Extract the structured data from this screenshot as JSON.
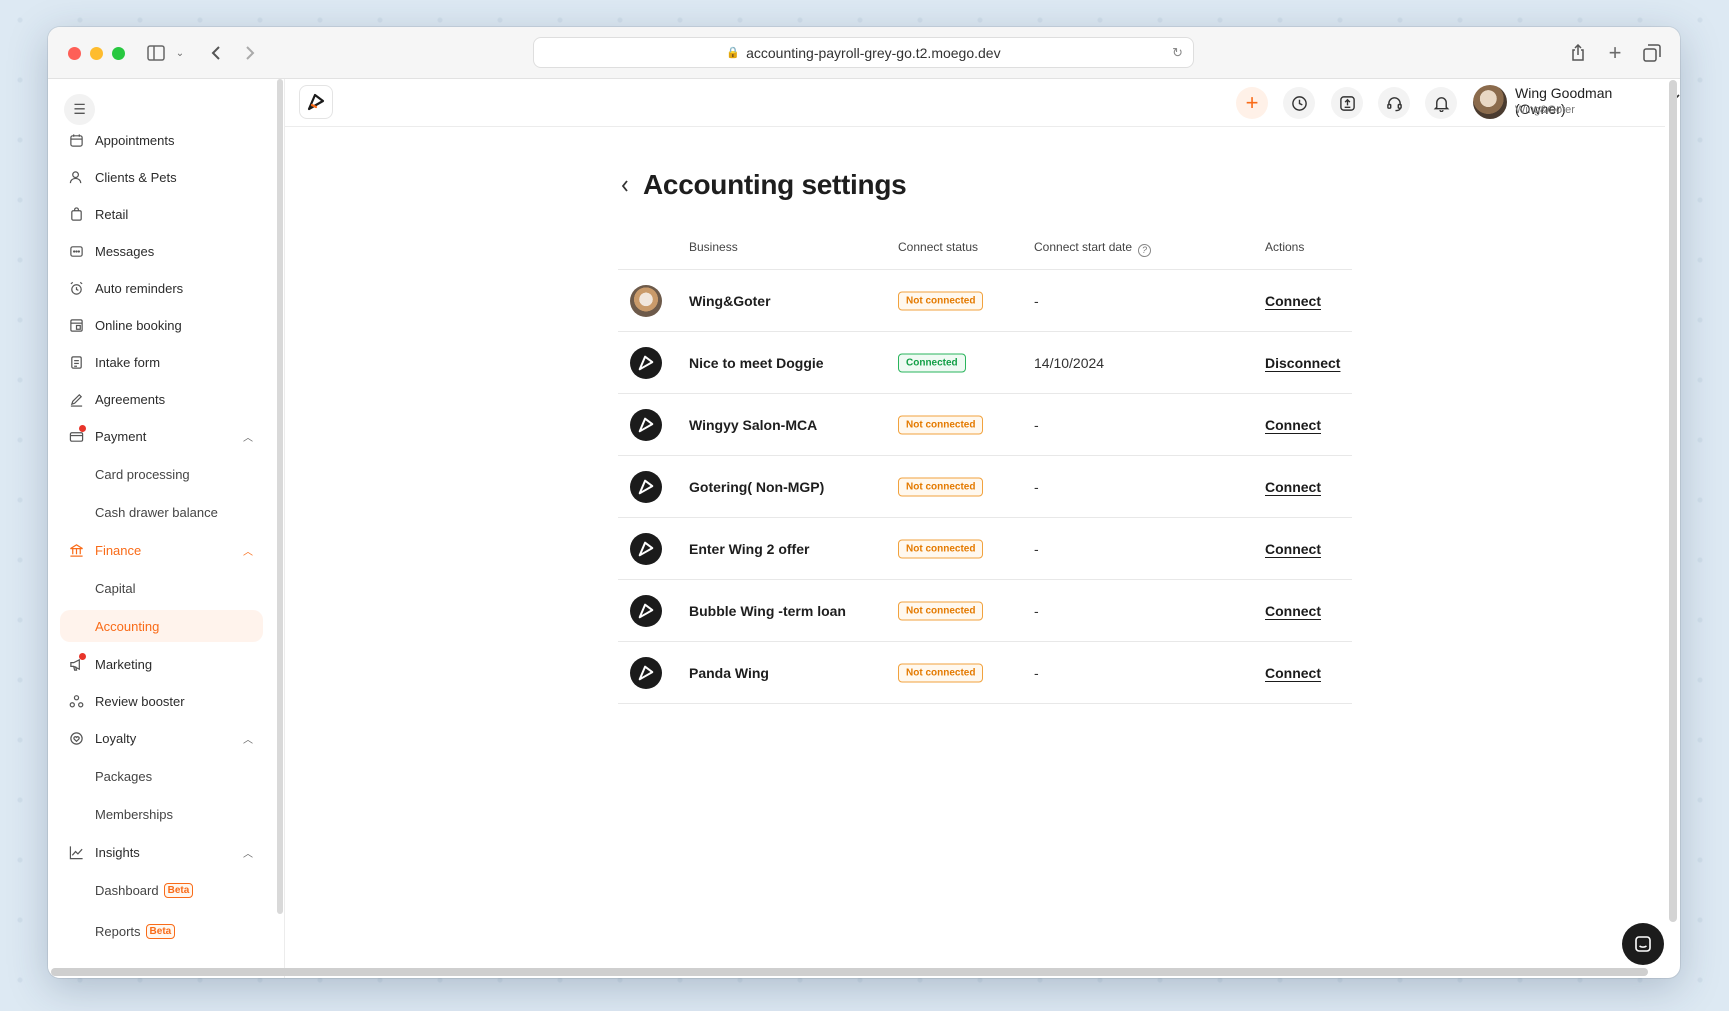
{
  "browser": {
    "url": "accounting-payroll-grey-go.t2.moego.dev"
  },
  "sidebar": {
    "items": [
      {
        "label": "Appointments",
        "icon": "calendar-icon"
      },
      {
        "label": "Clients & Pets",
        "icon": "user-icon"
      },
      {
        "label": "Retail",
        "icon": "bag-icon"
      },
      {
        "label": "Messages",
        "icon": "message-icon"
      },
      {
        "label": "Auto reminders",
        "icon": "alarm-icon"
      },
      {
        "label": "Online booking",
        "icon": "booking-icon"
      },
      {
        "label": "Intake form",
        "icon": "form-icon"
      },
      {
        "label": "Agreements",
        "icon": "pen-icon"
      },
      {
        "label": "Payment",
        "icon": "payment-icon"
      },
      {
        "label": "Card processing"
      },
      {
        "label": "Cash drawer balance"
      },
      {
        "label": "Finance",
        "icon": "bank-icon"
      },
      {
        "label": "Capital"
      },
      {
        "label": "Accounting"
      },
      {
        "label": "Marketing",
        "icon": "megaphone-icon"
      },
      {
        "label": "Review booster",
        "icon": "review-icon"
      },
      {
        "label": "Loyalty",
        "icon": "loyalty-icon"
      },
      {
        "label": "Packages"
      },
      {
        "label": "Memberships"
      },
      {
        "label": "Insights",
        "icon": "chart-icon"
      },
      {
        "label": "Dashboard",
        "badge": "Beta"
      },
      {
        "label": "Reports",
        "badge": "Beta"
      }
    ]
  },
  "header": {
    "user_name": "Wing Goodman (Owner)",
    "business": "Wing&Goter"
  },
  "main": {
    "title": "Accounting settings",
    "columns": {
      "business": "Business",
      "status": "Connect status",
      "start_date": "Connect start date",
      "actions": "Actions"
    },
    "rows": [
      {
        "name": "Wing&Goter",
        "status": "Not connected",
        "date": "-",
        "action": "Connect"
      },
      {
        "name": "Nice to meet Doggie",
        "status": "Connected",
        "date": "14/10/2024",
        "action": "Disconnect"
      },
      {
        "name": "Wingyy Salon-MCA",
        "status": "Not connected",
        "date": "-",
        "action": "Connect"
      },
      {
        "name": "Gotering( Non-MGP)",
        "status": "Not connected",
        "date": "-",
        "action": "Connect"
      },
      {
        "name": "Enter Wing 2 offer",
        "status": "Not connected",
        "date": "-",
        "action": "Connect"
      },
      {
        "name": "Bubble Wing -term loan",
        "status": "Not connected",
        "date": "-",
        "action": "Connect"
      },
      {
        "name": "Panda Wing",
        "status": "Not connected",
        "date": "-",
        "action": "Connect"
      }
    ]
  },
  "colors": {
    "accent": "#f96b18",
    "connected": "#129f46",
    "not_connected": "#e47a00"
  }
}
